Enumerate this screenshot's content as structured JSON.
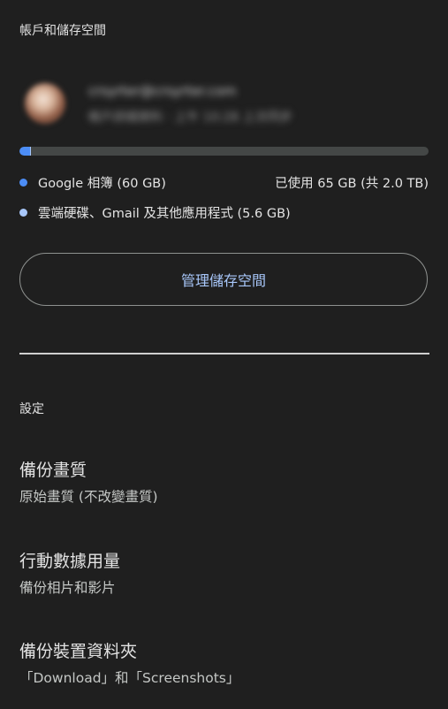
{
  "account_storage": {
    "header": "帳戶和儲存空間",
    "account": {
      "email": "crsyrter@crsyrter.com",
      "subtitle": "帳戶詳細資料 · 上午 10:28 上次同步"
    },
    "usage": {
      "photos_fraction": 0.0258,
      "other_fraction": 0.0024,
      "colors": {
        "photos": "#4c8df6",
        "other": "#a8c7fa",
        "track": "#444746"
      }
    },
    "legend": {
      "photos_label": "Google 相簿 (60 GB)",
      "used_total": "已使用 65 GB (共 2.0 TB)",
      "other_label": "雲端硬碟、Gmail 及其他應用程式 (5.6 GB)"
    },
    "manage_button_label": "管理儲存空間"
  },
  "settings": {
    "header": "設定",
    "items": [
      {
        "title": "備份畫質",
        "value": "原始畫質 (不改變畫質)"
      },
      {
        "title": "行動數據用量",
        "value": "備份相片和影片"
      },
      {
        "title": "備份裝置資料夾",
        "value": "「Download」和「Screenshots」"
      }
    ]
  },
  "colors": {
    "background": "#1f1f1f",
    "accent": "#a8c7fa"
  }
}
